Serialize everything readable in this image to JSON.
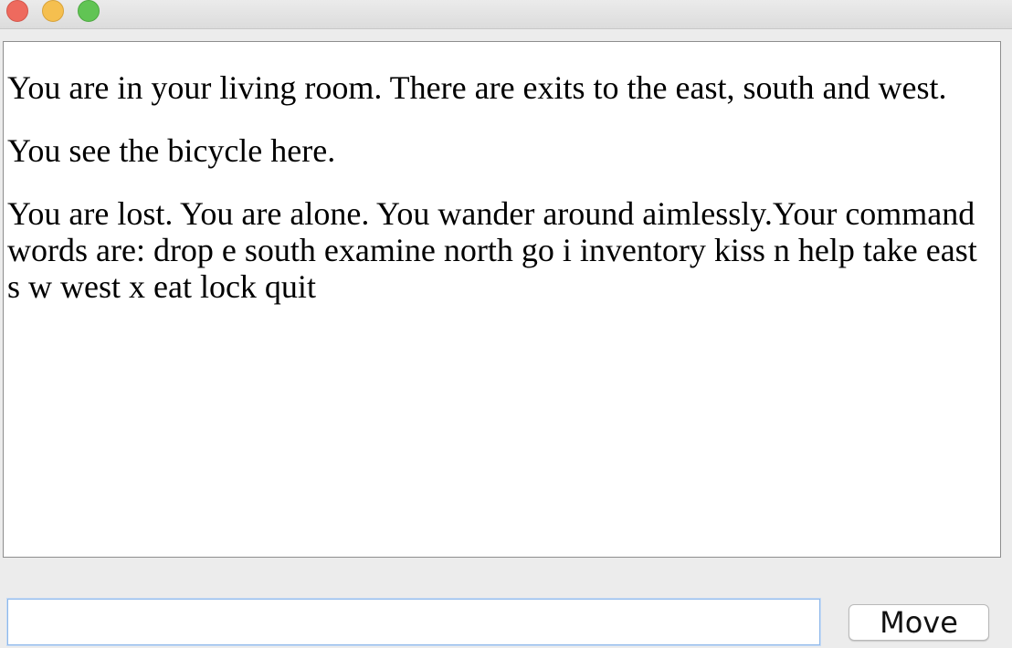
{
  "window": {
    "traffic_lights": {
      "close_color": "#ee6a5e",
      "minimize_color": "#f5bf4f",
      "maximize_color": "#61c454"
    }
  },
  "output": {
    "paragraphs": [
      "You are in your living room. There are exits to the east, south and west.",
      "You see the bicycle here.",
      "You are lost. You are alone. You wander around aimlessly.Your command words are: drop e south examine north go i inventory kiss n help take east s w west x eat lock quit"
    ]
  },
  "command": {
    "value": "",
    "placeholder": ""
  },
  "buttons": {
    "move_label": "Move"
  },
  "colors": {
    "input_focus_border": "#8fb8ea",
    "window_background": "#ececec"
  }
}
